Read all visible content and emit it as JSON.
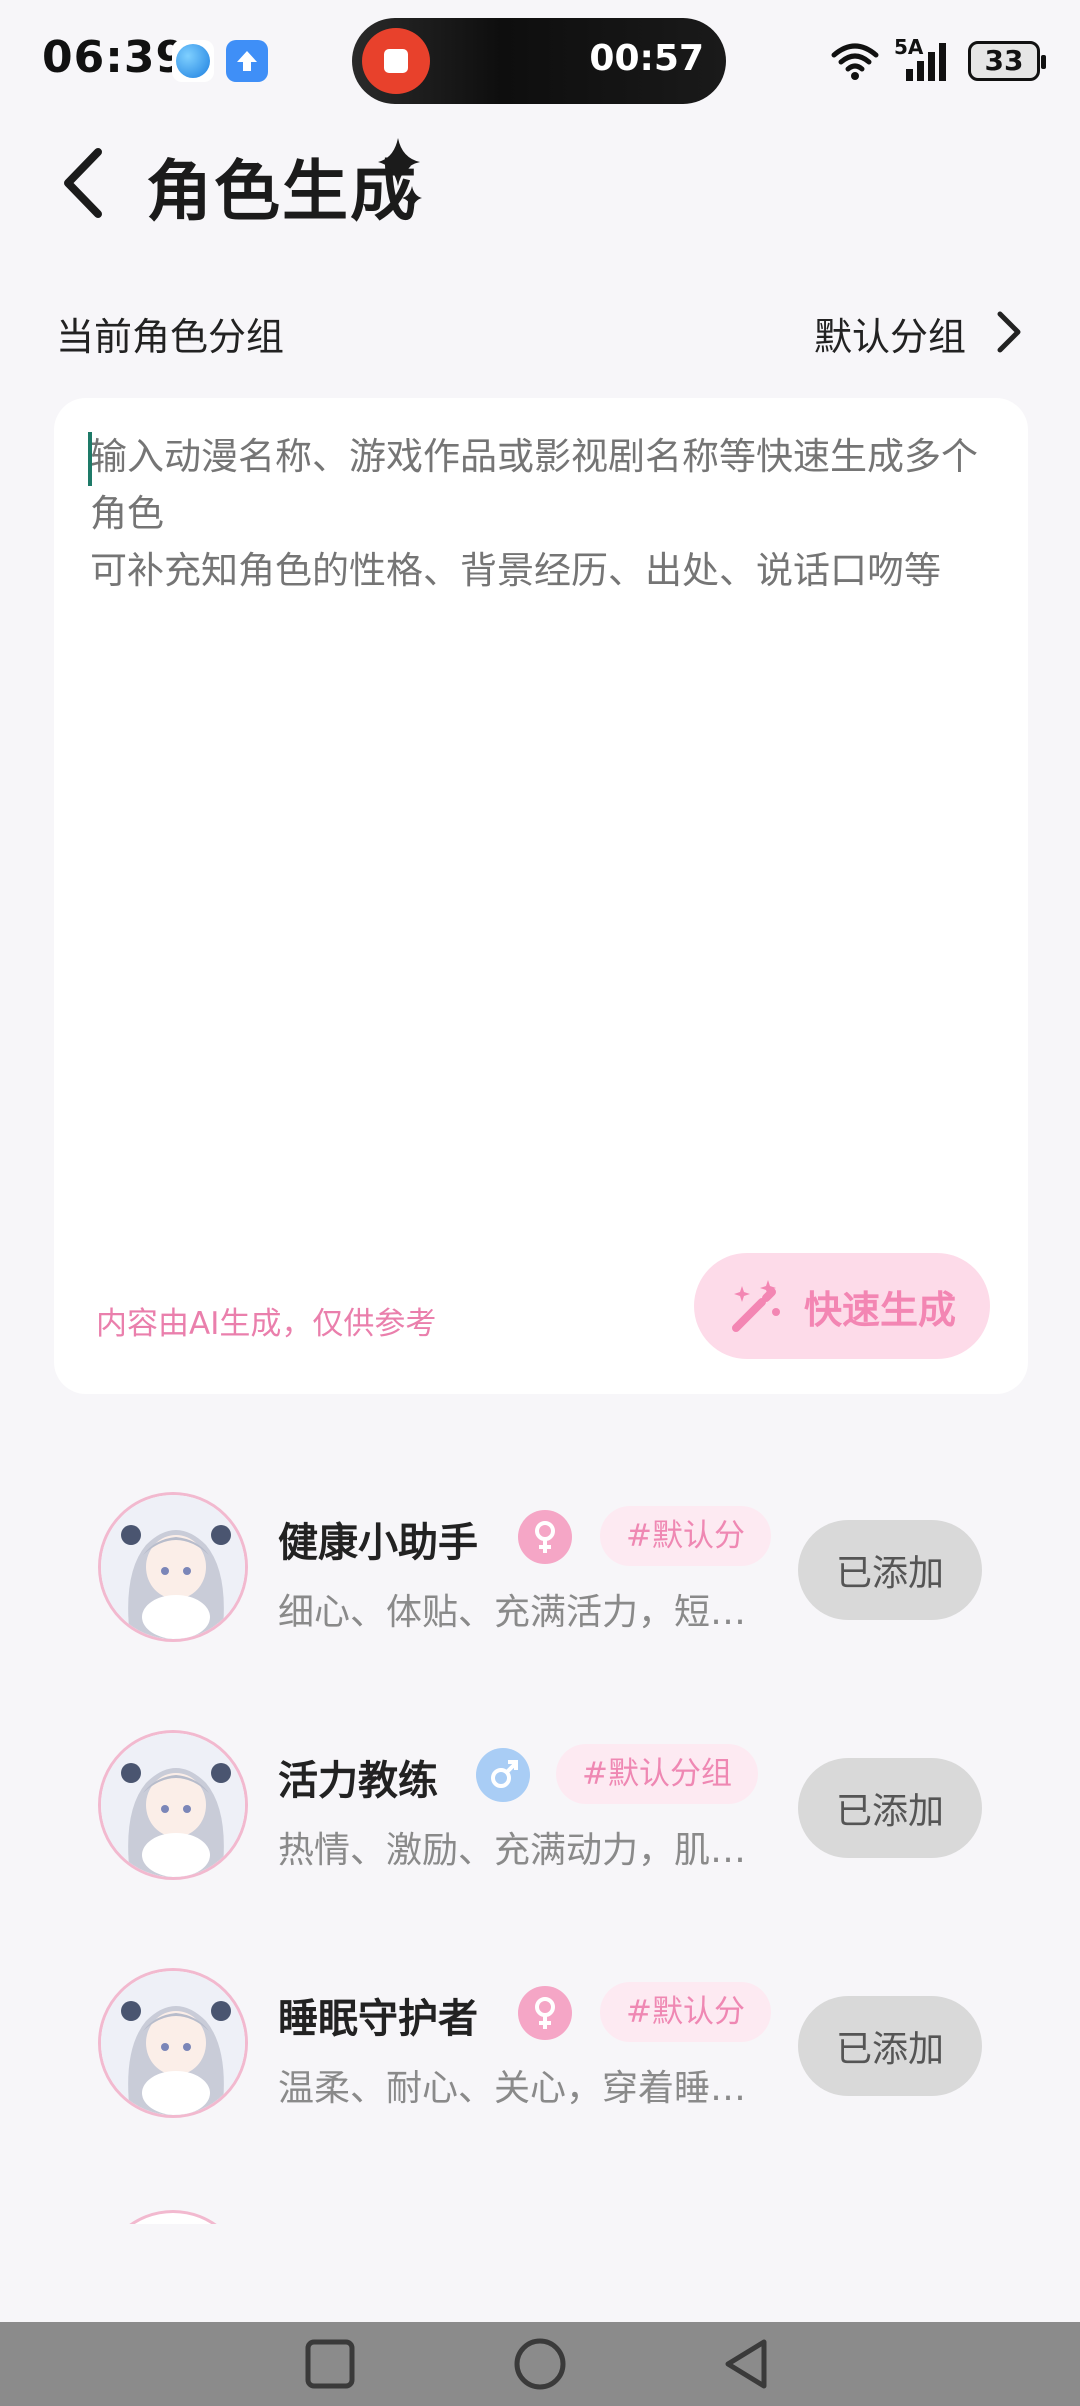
{
  "status_bar": {
    "time": "06:39",
    "recording_time": "00:57",
    "network": "5A",
    "battery": "33",
    "icons": [
      "app-icon-blue-globe",
      "app-icon-upload",
      "record-stop-icon",
      "wifi-icon",
      "signal-icon",
      "battery-icon"
    ]
  },
  "header": {
    "title": "角色生成",
    "back_icon": "chevron-left-icon",
    "decoration_icon": "sparkle-icon"
  },
  "group": {
    "label": "当前角色分组",
    "value": "默认分组"
  },
  "input": {
    "placeholder": "输入动漫名称、游戏作品或影视剧名称等快速生成多个角色\n可补充知角色的性格、背景经历、出处、说话口吻等",
    "disclaimer": "内容由AI生成，仅供参考",
    "quick_generate_label": "快速生成",
    "quick_generate_icon": "magic-wand-icon"
  },
  "characters": [
    {
      "name": "健康小助手",
      "gender": "female",
      "tag": "#默认分",
      "description": "细心、体贴、充满活力，短…",
      "button": "已添加"
    },
    {
      "name": "活力教练",
      "gender": "male",
      "tag": "#默认分组",
      "description": "热情、激励、充满动力，肌…",
      "button": "已添加"
    },
    {
      "name": "睡眠守护者",
      "gender": "female",
      "tag": "#默认分",
      "description": "温柔、耐心、关心，穿着睡…",
      "button": "已添加"
    }
  ],
  "colors": {
    "accent_pink": "#f386b3",
    "tag_bg": "#fdeaf2",
    "button_gray": "#d9d9d9",
    "nav_bar": "#8b8b8b"
  }
}
